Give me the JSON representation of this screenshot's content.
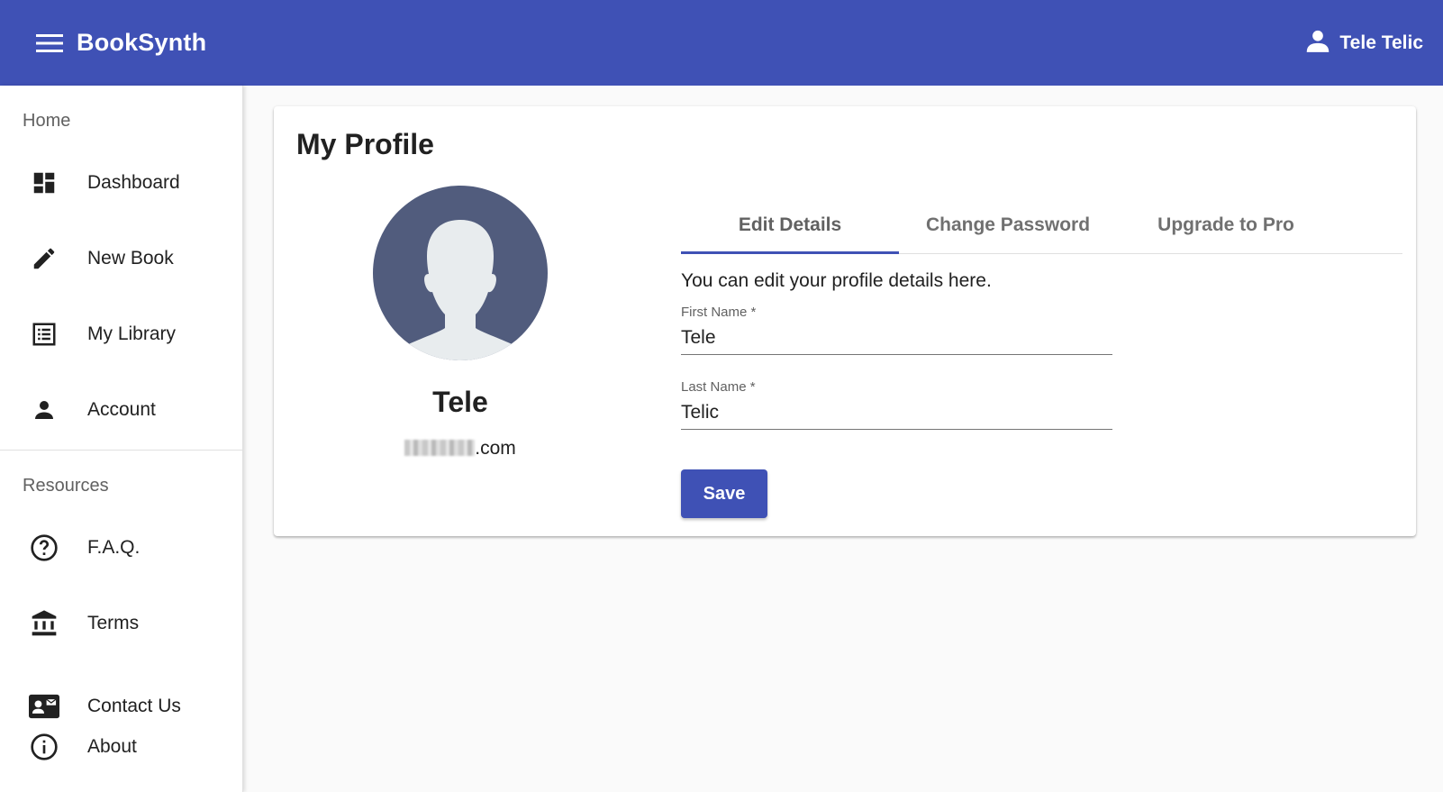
{
  "app": {
    "title": "BookSynth",
    "user_name": "Tele Telic"
  },
  "colors": {
    "primary": "#3f51b5",
    "background": "#fafafa",
    "avatar": "#515c7d"
  },
  "sidebar": {
    "sections": [
      {
        "title": "Home",
        "items": [
          {
            "label": "Dashboard",
            "icon": "dashboard-icon"
          },
          {
            "label": "New Book",
            "icon": "pencil-icon"
          },
          {
            "label": "My Library",
            "icon": "list-icon"
          },
          {
            "label": "Account",
            "icon": "person-icon"
          }
        ]
      },
      {
        "title": "Resources",
        "items": [
          {
            "label": "F.A.Q.",
            "icon": "help-circle-icon"
          },
          {
            "label": "Terms",
            "icon": "bank-icon"
          },
          {
            "label": "Contact Us",
            "icon": "contact-card-icon"
          },
          {
            "label": "About",
            "icon": "info-icon"
          }
        ]
      }
    ]
  },
  "profile": {
    "heading": "My Profile",
    "name": "Tele",
    "email_suffix": ".com",
    "tabs": [
      {
        "label": "Edit Details",
        "active": true
      },
      {
        "label": "Change Password",
        "active": false
      },
      {
        "label": "Upgrade to Pro",
        "active": false
      }
    ],
    "intro": "You can edit your profile details here.",
    "first_name": {
      "label": "First Name *",
      "value": "Tele"
    },
    "last_name": {
      "label": "Last Name *",
      "value": "Telic"
    },
    "save_label": "Save"
  }
}
